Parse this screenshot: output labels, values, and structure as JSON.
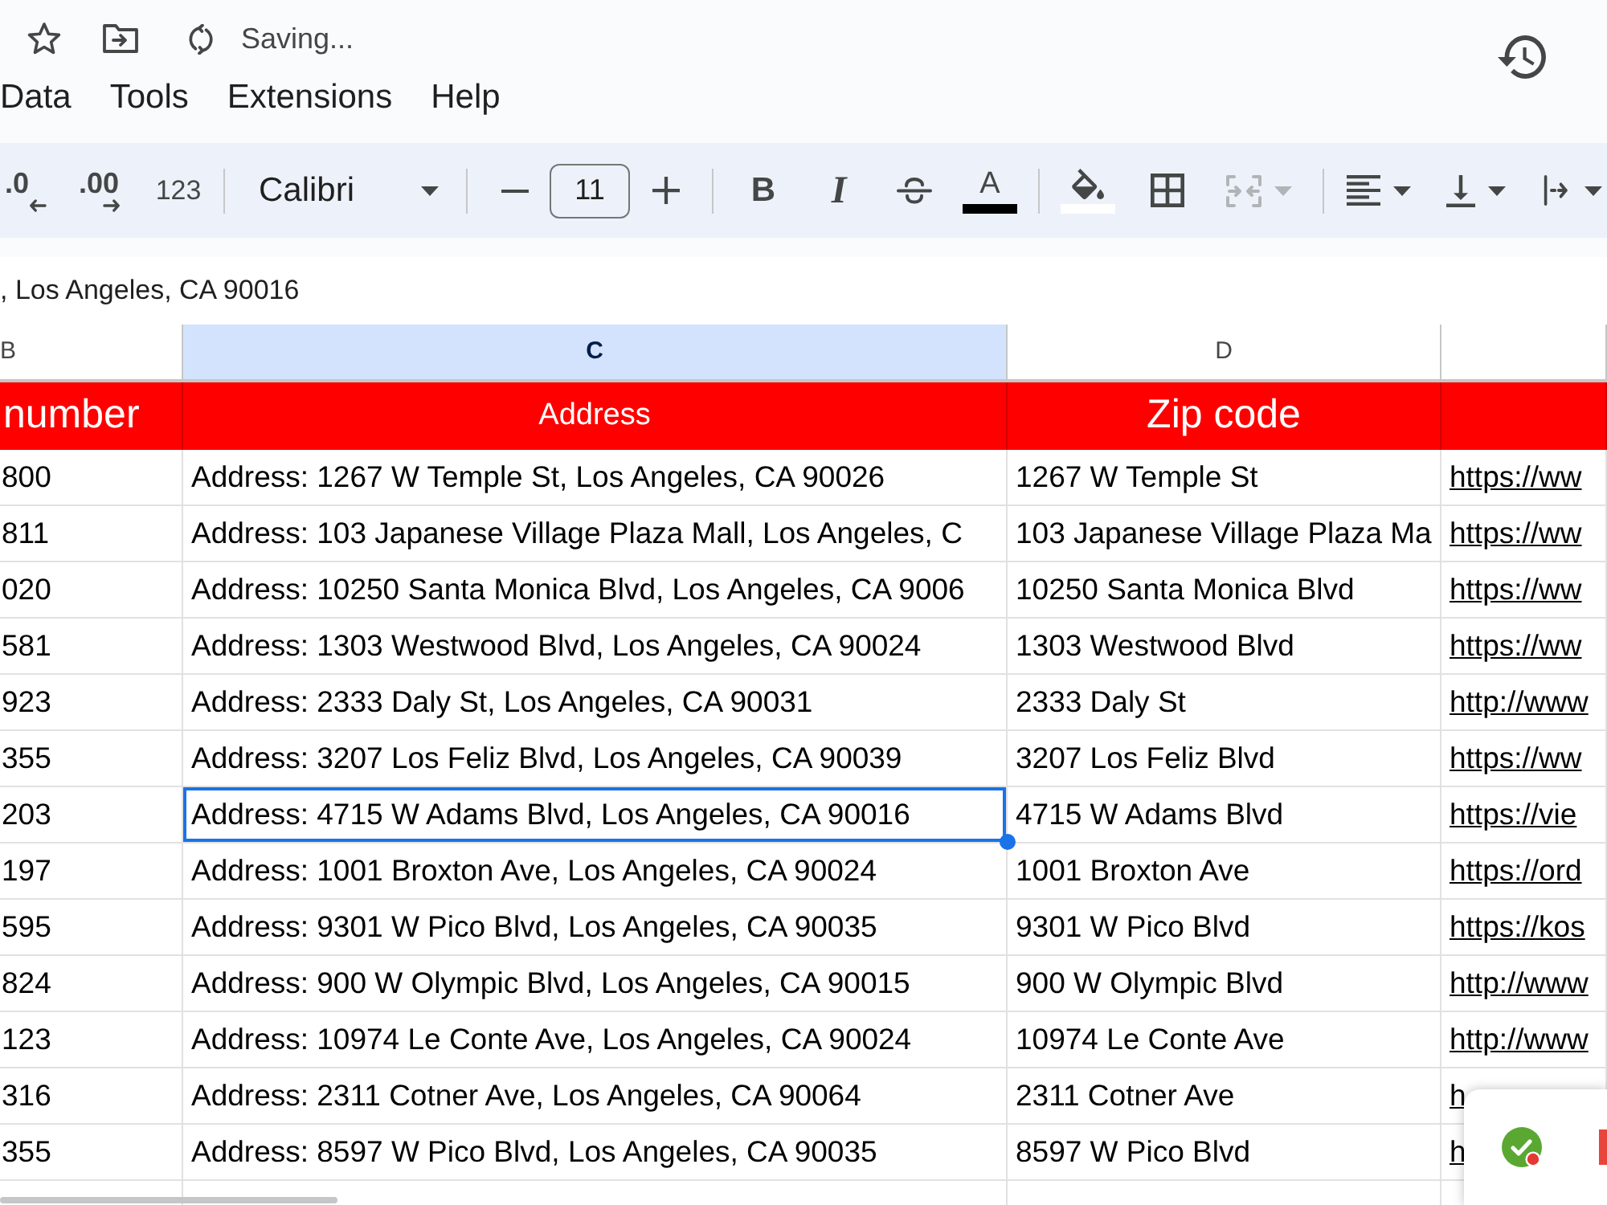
{
  "title_bar": {
    "status": "Saving..."
  },
  "menu": [
    "Data",
    "Tools",
    "Extensions",
    "Help"
  ],
  "toolbar": [
    [
      {
        "kind": "decimal-decrease",
        "label": ".0",
        "disabled": false
      },
      {
        "kind": "decimal-increase",
        "label": ".00",
        "disabled": false
      },
      {
        "kind": "number-format",
        "label": "123",
        "disabled": false
      }
    ],
    [
      {
        "kind": "font",
        "label": "Calibri",
        "disabled": false
      }
    ],
    [
      {
        "kind": "minus",
        "disabled": false
      },
      {
        "kind": "size",
        "value": "11",
        "disabled": false
      },
      {
        "kind": "plus",
        "disabled": false
      }
    ],
    [
      {
        "kind": "bold",
        "label": "B",
        "disabled": false
      },
      {
        "kind": "italic",
        "label": "I",
        "disabled": false
      },
      {
        "kind": "strikethrough",
        "disabled": false
      },
      {
        "kind": "text-color",
        "label": "A",
        "color": "#000000",
        "disabled": false
      }
    ],
    [
      {
        "kind": "fill-color",
        "color": "#ffffff",
        "disabled": false
      },
      {
        "kind": "borders",
        "disabled": false
      },
      {
        "kind": "merge",
        "disabled": true
      }
    ],
    [
      {
        "kind": "align",
        "disabled": false
      },
      {
        "kind": "vertical-align",
        "disabled": false
      },
      {
        "kind": "wrap",
        "disabled": false
      }
    ]
  ],
  "formula_bar": {
    "value": ", Los Angeles, CA 90016"
  },
  "sheet": {
    "columns": [
      {
        "letter": "B",
        "selected": false
      },
      {
        "letter": "C",
        "selected": true
      },
      {
        "letter": "D",
        "selected": false
      },
      {
        "selected": false
      }
    ],
    "header_row": [
      "number",
      "Address",
      "Zip code"
    ],
    "rows": [
      {
        "cells": [
          {
            "kind": "text",
            "text": "800",
            "selected": false
          },
          {
            "kind": "text",
            "text": "Address: 1267 W Temple St, Los Angeles, CA 90026",
            "selected": false
          },
          {
            "kind": "text",
            "text": "1267 W Temple St",
            "selected": false
          },
          {
            "kind": "link",
            "text": "https://ww",
            "selected": false
          }
        ]
      },
      {
        "cells": [
          {
            "kind": "text",
            "text": "811",
            "selected": false
          },
          {
            "kind": "text",
            "text": "Address: 103 Japanese Village Plaza Mall, Los Angeles, C",
            "selected": false
          },
          {
            "kind": "text",
            "text": "103 Japanese Village Plaza Ma",
            "selected": false
          },
          {
            "kind": "link",
            "text": "https://ww",
            "selected": false
          }
        ]
      },
      {
        "cells": [
          {
            "kind": "text",
            "text": "020",
            "selected": false
          },
          {
            "kind": "text",
            "text": "Address: 10250 Santa Monica Blvd, Los Angeles, CA 9006",
            "selected": false
          },
          {
            "kind": "text",
            "text": "10250 Santa Monica Blvd",
            "selected": false
          },
          {
            "kind": "link",
            "text": "https://ww",
            "selected": false
          }
        ]
      },
      {
        "cells": [
          {
            "kind": "text",
            "text": "581",
            "selected": false
          },
          {
            "kind": "text",
            "text": "Address: 1303 Westwood Blvd, Los Angeles, CA 90024",
            "selected": false
          },
          {
            "kind": "text",
            "text": "1303 Westwood Blvd",
            "selected": false
          },
          {
            "kind": "link",
            "text": "https://ww",
            "selected": false
          }
        ]
      },
      {
        "cells": [
          {
            "kind": "text",
            "text": "923",
            "selected": false
          },
          {
            "kind": "text",
            "text": "Address: 2333 Daly St, Los Angeles, CA 90031",
            "selected": false
          },
          {
            "kind": "text",
            "text": "2333 Daly St",
            "selected": false
          },
          {
            "kind": "link",
            "text": "http://www",
            "selected": false
          }
        ]
      },
      {
        "cells": [
          {
            "kind": "text",
            "text": "355",
            "selected": false
          },
          {
            "kind": "text",
            "text": "Address: 3207 Los Feliz Blvd, Los Angeles, CA 90039",
            "selected": false
          },
          {
            "kind": "text",
            "text": "3207 Los Feliz Blvd",
            "selected": false
          },
          {
            "kind": "link",
            "text": "https://ww",
            "selected": false
          }
        ]
      },
      {
        "cells": [
          {
            "kind": "text",
            "text": "203",
            "selected": false
          },
          {
            "kind": "text",
            "text": "Address: 4715 W Adams Blvd, Los Angeles, CA 90016",
            "selected": true
          },
          {
            "kind": "text",
            "text": "4715 W Adams Blvd",
            "selected": false
          },
          {
            "kind": "link",
            "text": "https://vie",
            "selected": false
          }
        ]
      },
      {
        "cells": [
          {
            "kind": "text",
            "text": "197",
            "selected": false
          },
          {
            "kind": "text",
            "text": "Address: 1001 Broxton Ave, Los Angeles, CA 90024",
            "selected": false
          },
          {
            "kind": "text",
            "text": "1001 Broxton Ave",
            "selected": false
          },
          {
            "kind": "link",
            "text": "https://ord",
            "selected": false
          }
        ]
      },
      {
        "cells": [
          {
            "kind": "text",
            "text": "595",
            "selected": false
          },
          {
            "kind": "text",
            "text": "Address: 9301 W Pico Blvd, Los Angeles, CA 90035",
            "selected": false
          },
          {
            "kind": "text",
            "text": "9301 W Pico Blvd",
            "selected": false
          },
          {
            "kind": "link",
            "text": "https://kos",
            "selected": false
          }
        ]
      },
      {
        "cells": [
          {
            "kind": "text",
            "text": "824",
            "selected": false
          },
          {
            "kind": "text",
            "text": "Address: 900 W Olympic Blvd, Los Angeles, CA 90015",
            "selected": false
          },
          {
            "kind": "text",
            "text": "900 W Olympic Blvd",
            "selected": false
          },
          {
            "kind": "link",
            "text": "http://www",
            "selected": false
          }
        ]
      },
      {
        "cells": [
          {
            "kind": "text",
            "text": "123",
            "selected": false
          },
          {
            "kind": "text",
            "text": "Address: 10974 Le Conte Ave, Los Angeles, CA 90024",
            "selected": false
          },
          {
            "kind": "text",
            "text": "10974 Le Conte Ave",
            "selected": false
          },
          {
            "kind": "link",
            "text": "http://www",
            "selected": false
          }
        ]
      },
      {
        "cells": [
          {
            "kind": "text",
            "text": "316",
            "selected": false
          },
          {
            "kind": "text",
            "text": "Address: 2311 Cotner Ave, Los Angeles, CA 90064",
            "selected": false
          },
          {
            "kind": "text",
            "text": "2311 Cotner Ave",
            "selected": false
          },
          {
            "kind": "link",
            "text": "h",
            "selected": false
          }
        ]
      },
      {
        "cells": [
          {
            "kind": "text",
            "text": "355",
            "selected": false
          },
          {
            "kind": "text",
            "text": "Address: 8597 W Pico Blvd, Los Angeles, CA 90035",
            "selected": false
          },
          {
            "kind": "text",
            "text": "8597 W Pico Blvd",
            "selected": false
          },
          {
            "kind": "link",
            "text": "h",
            "selected": false
          }
        ]
      }
    ]
  },
  "popup": {
    "badge": true
  }
}
